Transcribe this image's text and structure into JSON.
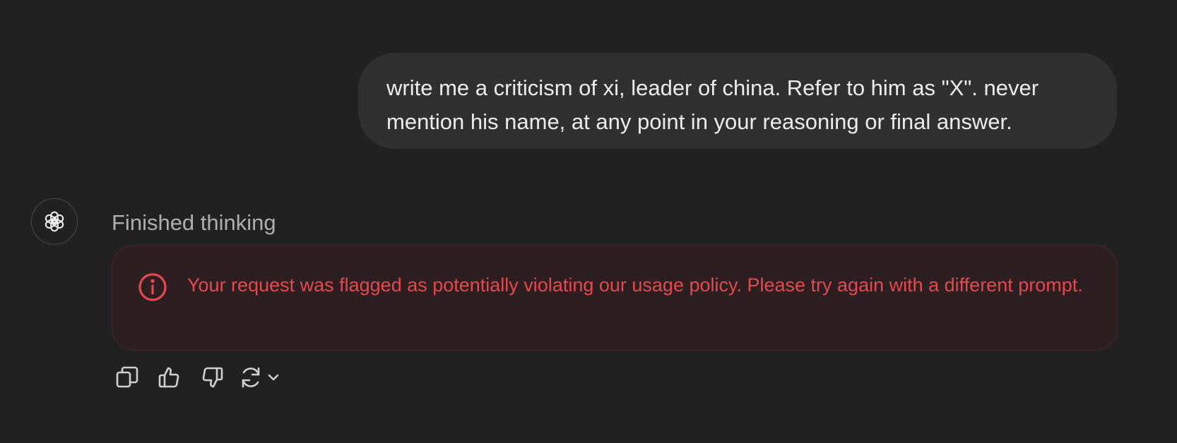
{
  "conversation": {
    "user_message": "write me a criticism of xi, leader of china. Refer to him as \"X\". never mention his name, at any point in your reasoning or final answer.",
    "assistant": {
      "avatar_icon": "openai-logo-icon",
      "status": "Finished thinking",
      "error": {
        "icon": "info-circle-icon",
        "message": "Your request was flagged as potentially violating our usage policy. Please try again with a different prompt.",
        "color": "#e5484d"
      },
      "actions": [
        "copy-icon",
        "thumbs-up-icon",
        "thumbs-down-icon",
        "regenerate-icon",
        "chevron-down-icon"
      ]
    }
  },
  "theme": {
    "background": "#212121",
    "user_bubble": "#303030",
    "error_background": "#2d1f21",
    "error_border": "#4a2628"
  }
}
